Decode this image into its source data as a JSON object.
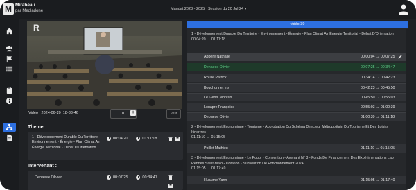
{
  "header": {
    "app_title": "Mirabeau",
    "app_subtitle": "par Mediadone",
    "logo_glyph": "M",
    "mandat": "Mandat 2023 - 2025",
    "session": "Session du 20 Jul 24 ▾"
  },
  "sidebar": {
    "items": [
      "home-icon",
      "users-icon",
      "flag-icon",
      "list-icon",
      "clipboard-icon",
      "info-icon",
      "network-icon",
      "document-icon"
    ],
    "active": "network-icon"
  },
  "player": {
    "video_label": "Vidéo : 2024-06-20_18-33-46",
    "speed_value": "0",
    "plus_label": "+",
    "vest_label": "Vest"
  },
  "theme": {
    "heading": "Theme :",
    "text": "1 - Développement Durable Du Territoire - Environnement - Énergie - Plan Climat Air Énergie Territorial - Débat D'Orientation",
    "start": "00:04:20",
    "end": "01:11:18"
  },
  "intervenant": {
    "heading": "Intervenant :",
    "name": "Dehaese Olivier",
    "start": "00:07:25",
    "end": "00:34:47"
  },
  "right": {
    "tab_label": "vidéo 39",
    "topics": [
      {
        "title": "1 - Développement Durable Du Territoire - Environnement - Énergie - Plan Climat Air Énergie Territorial - Débat D'Orientation",
        "range": "00:04:20 → 01:11:18",
        "speakers": [
          {
            "name": "Appéré Nathalie",
            "time": "00:00:04 → 00:07:25"
          },
          {
            "name": "Dehaese Olivier",
            "time": "00:07:25 → 00:34:47"
          },
          {
            "name": "Roulle Patrick",
            "time": "00:34:14 → 00:42:23"
          },
          {
            "name": "Bouchonnet Iris",
            "time": "00:42:23 → 00:45:50"
          },
          {
            "name": "Le Gentil Morvan",
            "time": "00:45:50 → 00:55:03"
          },
          {
            "name": "Louapre Françoise",
            "time": "00:55:03 → 01:00:39"
          },
          {
            "name": "Debaese Olivier",
            "time": "01:00:39 → 01:11:18"
          }
        ]
      },
      {
        "title": "2 - Développement Économique - Tourisme - Approbation Du Schéma Directeur Métropolitain Du Tourisme Et Des Loisirs Itinerrres",
        "range": "01:11:19 → 01:15:05",
        "speakers": [
          {
            "name": "Poillet Mathieu",
            "time": "01:11:19 → 01:15:05"
          }
        ]
      },
      {
        "title": "3 - Développement Économique - Le Poool - Convention - Avenant N° 3 - Fonds De Financement Des Expérimentations Lab Rennes Saint-Malo - Dotation - Subvention De Fonctionnement 2024",
        "range": "01:15:05 → 01:17:49",
        "speakers": [
          {
            "name": "Huaume Yann",
            "time": "01:15:05 → 01:17:40"
          }
        ]
      }
    ]
  },
  "colors": {
    "accent": "#2d6fe0",
    "active_speaker": "#5fd28a",
    "background": "#1f2124"
  }
}
